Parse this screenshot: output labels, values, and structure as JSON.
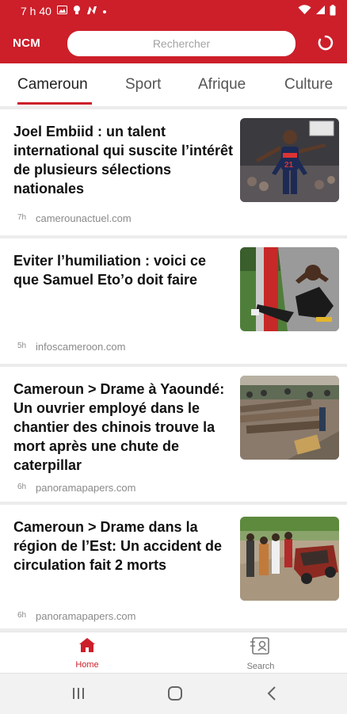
{
  "status_bar": {
    "time": "7 h 40"
  },
  "app": {
    "logo": "NCM",
    "search_placeholder": "Rechercher",
    "accent_color": "#cc1f2a"
  },
  "tabs": [
    {
      "label": "Cameroun",
      "active": true
    },
    {
      "label": "Sport",
      "active": false
    },
    {
      "label": "Afrique",
      "active": false
    },
    {
      "label": "Culture",
      "active": false
    }
  ],
  "articles": [
    {
      "title": "Joel Embiid : un talent international qui suscite l’intérêt de plusieurs sélections nationales",
      "time": "7h",
      "source": "camerounactuel.com",
      "thumb_icon": "basketball-player-image"
    },
    {
      "title": "Eviter l’humiliation : voici ce que Samuel Eto’o doit faire",
      "time": "5h",
      "source": "infoscameroon.com",
      "thumb_icon": "footballer-on-ground-image"
    },
    {
      "title": "Cameroun > Drame à Yaoundé: Un ouvrier employé dans le chantier des chinois trouve la mort après une chute de caterpillar",
      "time": "6h",
      "source": "panoramapapers.com",
      "thumb_icon": "construction-site-image"
    },
    {
      "title": "Cameroun > Drame dans la région de l’Est: Un accident de circulation fait 2 morts",
      "time": "6h",
      "source": "panoramapapers.com",
      "thumb_icon": "road-accident-image"
    }
  ],
  "bottom_nav": [
    {
      "label": "Home",
      "icon": "home-icon",
      "active": true
    },
    {
      "label": "Search",
      "icon": "search-card-icon",
      "active": false
    }
  ]
}
